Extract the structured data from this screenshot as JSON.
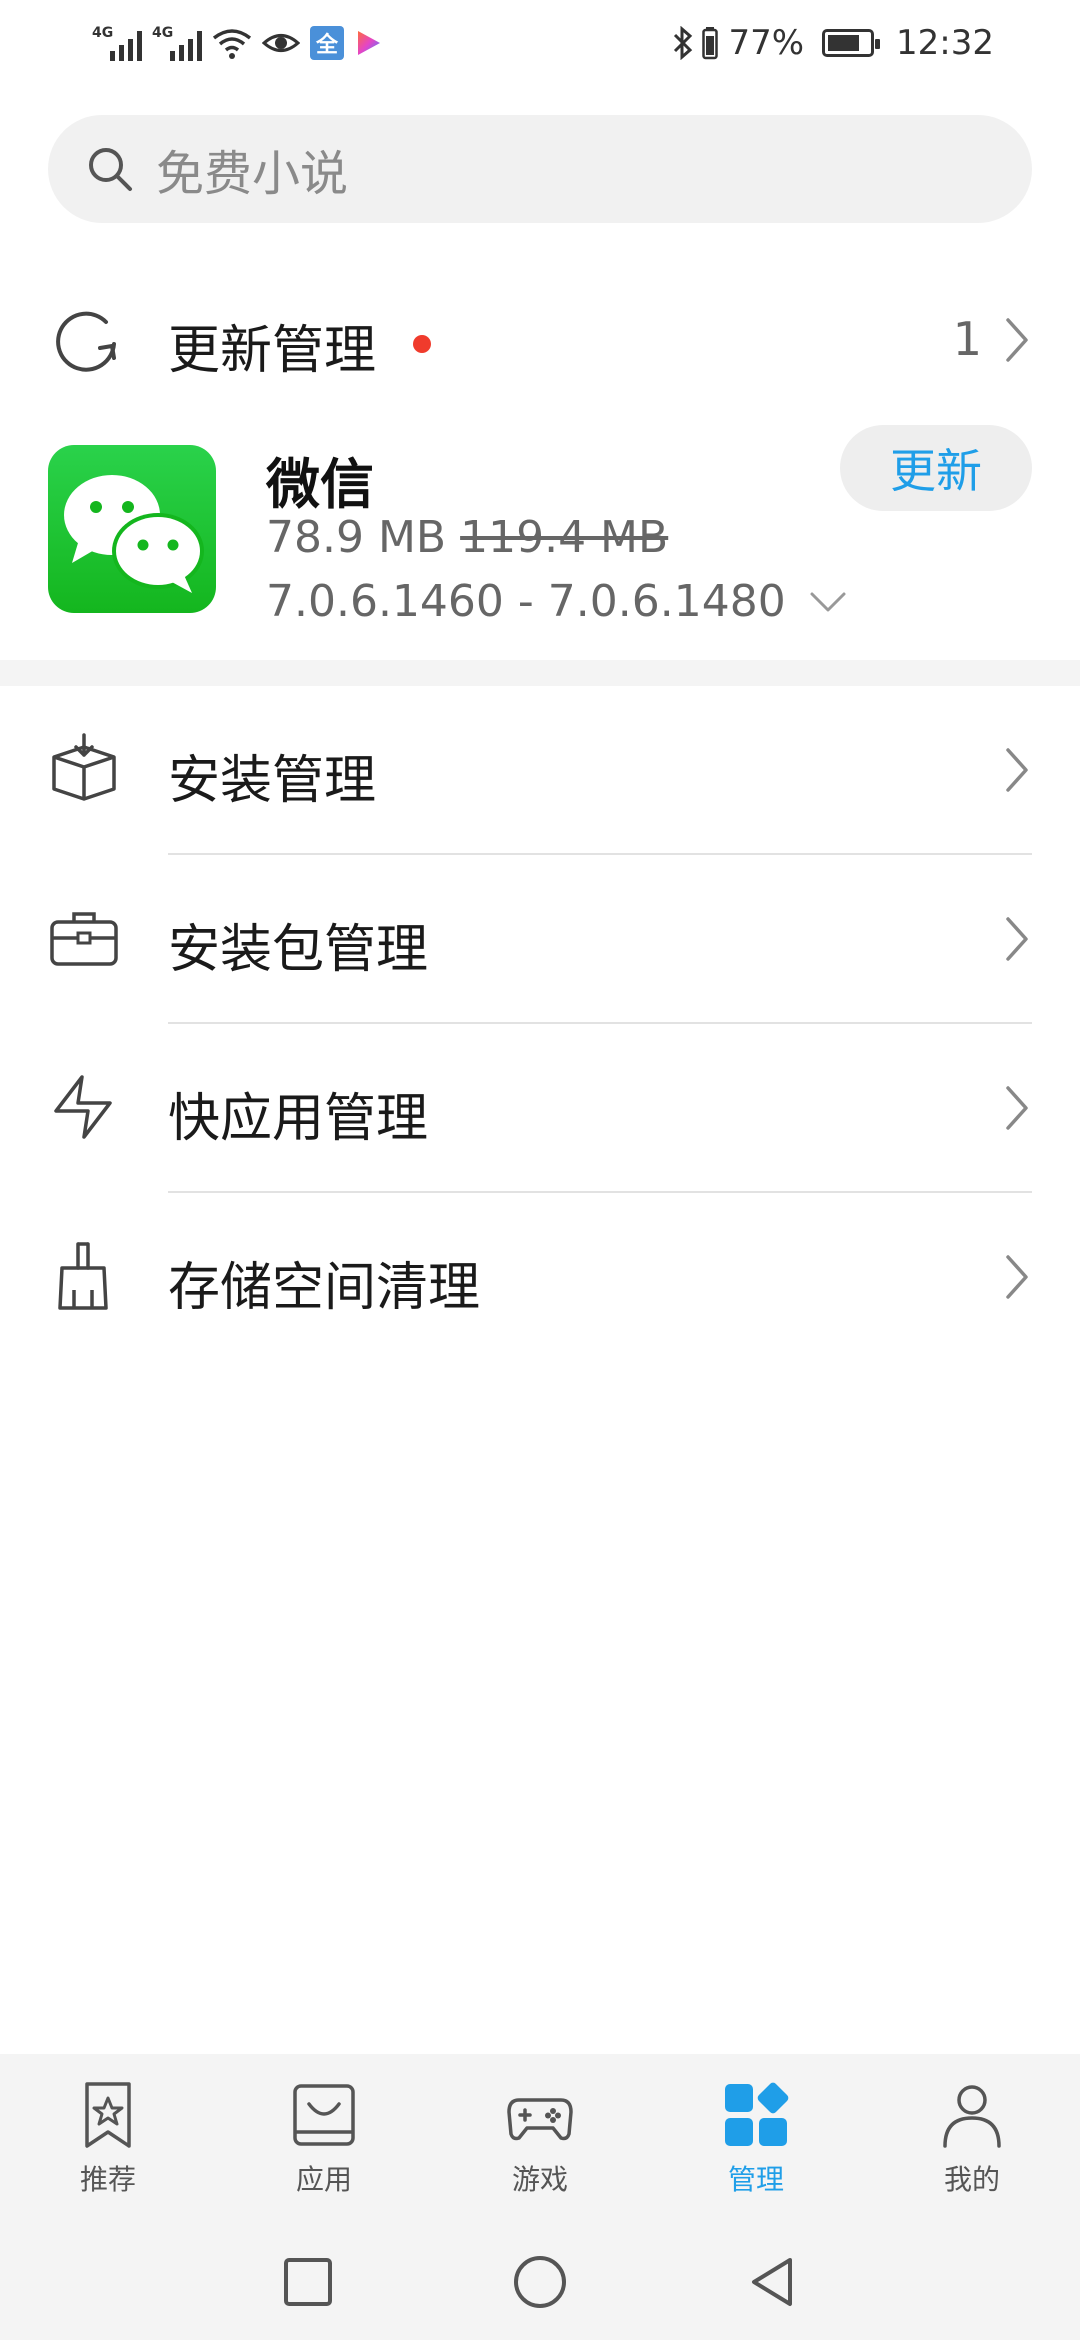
{
  "status_bar": {
    "network_1": "4G",
    "network_2": "4G",
    "quanjia_badge": "全",
    "battery_percent": "77%",
    "battery_level": 0.77,
    "time": "12:32",
    "icons": [
      "signal-icon",
      "signal-icon",
      "wifi-icon",
      "eye-icon",
      "quanjia-app-icon",
      "video-app-icon",
      "bluetooth-icon",
      "battery-icon",
      "eco-battery-icon"
    ]
  },
  "search": {
    "placeholder": "免费小说",
    "icon": "search-icon"
  },
  "update_section": {
    "title": "更新管理",
    "count": "1",
    "icon": "refresh-icon",
    "has_red_dot": true
  },
  "pending_update": {
    "app_name": "微信",
    "new_size": "78.9 MB",
    "old_size": "119.4 MB",
    "version_range": "7.0.6.1460 - 7.0.6.1480",
    "update_button": "更新",
    "icon": "wechat-app-icon"
  },
  "menu": {
    "items": [
      {
        "label": "安装管理",
        "icon": "install-box-icon"
      },
      {
        "label": "安装包管理",
        "icon": "briefcase-icon"
      },
      {
        "label": "快应用管理",
        "icon": "quick-app-bolt-icon"
      },
      {
        "label": "存储空间清理",
        "icon": "broom-icon"
      }
    ]
  },
  "tabs": [
    {
      "label": "推荐",
      "icon": "star-bookmark-icon",
      "active": false
    },
    {
      "label": "应用",
      "icon": "shopping-bag-icon",
      "active": false
    },
    {
      "label": "游戏",
      "icon": "gamepad-icon",
      "active": false
    },
    {
      "label": "管理",
      "icon": "grid-manage-icon",
      "active": true
    },
    {
      "label": "我的",
      "icon": "person-icon",
      "active": false
    }
  ],
  "colors": {
    "accent": "#1f9ee8",
    "red_dot": "#f03b2c",
    "wechat_green": "#1aaf26"
  }
}
